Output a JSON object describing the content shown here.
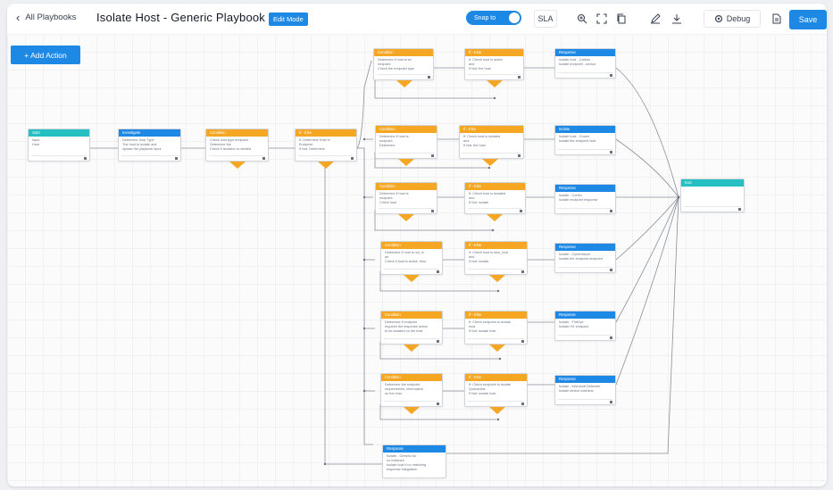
{
  "topbar": {
    "back_label": "All Playbooks",
    "title": "Isolate Host - Generic Playbook",
    "edit_label": "Edit Mode",
    "toggle_label": "Snap to",
    "sla_label": "SLA",
    "debug_label": "Debug",
    "save_label": "Save"
  },
  "canvas": {
    "add_action_label": "+ Add Action"
  },
  "colors": {
    "accent": "#1e88e5",
    "condition": "#f5a623",
    "start_end": "#26bfc2"
  },
  "nodes": [
    {
      "id": "start",
      "type": "teal",
      "title": "Start",
      "lines": [
        "Input",
        "Host"
      ]
    },
    {
      "id": "n1",
      "type": "blue",
      "title": "Investigate",
      "lines": [
        "Determine Host Type",
        "The host to isolate and",
        "update the playbook input"
      ]
    },
    {
      "id": "n2",
      "type": "orange",
      "title": "Condition",
      "lines": [
        "Check host type endpoint",
        "Determine the",
        "Check if isolation is needed"
      ]
    },
    {
      "id": "n3",
      "type": "orange",
      "title": "If - Else",
      "lines": [
        "If: Determine Host is",
        "Endpoint",
        "If Not: Determine"
      ]
    },
    {
      "id": "c1",
      "type": "orange",
      "title": "Condition",
      "lines": [
        "Determine if host is an",
        "endpoint",
        "Check the endpoint type"
      ]
    },
    {
      "id": "c2",
      "type": "orange",
      "title": "Condition",
      "lines": [
        "Determine if host is",
        "endpoint",
        "Determine"
      ]
    },
    {
      "id": "c3",
      "type": "orange",
      "title": "Condition",
      "lines": [
        "Determine if host is",
        "endpoint",
        "Check host"
      ]
    },
    {
      "id": "c4",
      "type": "orange",
      "title": "Condition",
      "lines": [
        "Determine if host is not_in",
        "an",
        "Check if host is active, then"
      ]
    },
    {
      "id": "c5",
      "type": "orange",
      "title": "Condition",
      "lines": [
        "Determine if endpoint",
        "requires the response action",
        "to be isolated on the host"
      ]
    },
    {
      "id": "c6",
      "type": "orange",
      "title": "Condition",
      "lines": [
        "Determine the endpoint",
        "requirements, information",
        "on the host"
      ]
    },
    {
      "id": "i1",
      "type": "orange",
      "title": "If - Else",
      "lines": [
        "If: Check host is active",
        "and",
        "If Not: the host"
      ]
    },
    {
      "id": "i2",
      "type": "orange",
      "title": "If - Else",
      "lines": [
        "If: Check host is isolated",
        "and",
        "If Not: the host"
      ]
    },
    {
      "id": "i3",
      "type": "orange",
      "title": "If - Else",
      "lines": [
        "If: Check host is isolated",
        "and",
        "If Not: isolate"
      ]
    },
    {
      "id": "i4",
      "type": "orange",
      "title": "If - Else",
      "lines": [
        "If: Check host is new_host",
        "and",
        "If Not: Isolate"
      ]
    },
    {
      "id": "i5",
      "type": "orange",
      "title": "If - Else",
      "lines": [
        "If: Check endpoint to isolate",
        "host",
        "If Not: isolate host"
      ]
    },
    {
      "id": "i6",
      "type": "orange",
      "title": "If - Else",
      "lines": [
        "If: Check endpoint to isolate",
        "Quarantine",
        "If Not: isolate host"
      ]
    },
    {
      "id": "a1",
      "type": "blue",
      "title": "Response",
      "lines": [
        "Isolate host - Carbon",
        "Isolate endpoint - sensor"
      ]
    },
    {
      "id": "a2",
      "type": "blue",
      "title": "Isolate",
      "lines": [
        "Isolate host - Crowd",
        "Isolate the endpoint host"
      ]
    },
    {
      "id": "a3",
      "type": "blue",
      "title": "Response",
      "lines": [
        "Isolate - Cortex",
        "Isolate endpoint response"
      ]
    },
    {
      "id": "a4",
      "type": "blue",
      "title": "Response",
      "lines": [
        "Isolate - Cybereason",
        "Isolate the endpoint endpoint"
      ]
    },
    {
      "id": "a5",
      "type": "blue",
      "title": "Response",
      "lines": [
        "Isolate - FireEye",
        "Isolate HX endpoint"
      ]
    },
    {
      "id": "a6",
      "type": "blue",
      "title": "Response",
      "lines": [
        "Isolate - Microsoft Defender",
        "Isolate device machine"
      ]
    },
    {
      "id": "a7",
      "type": "blue",
      "title": "Response",
      "lines": [
        "Isolate - Generic for",
        "no matches",
        "Isolate host if no matching",
        "response integration"
      ]
    },
    {
      "id": "end",
      "type": "teal",
      "title": "End",
      "lines": []
    }
  ]
}
